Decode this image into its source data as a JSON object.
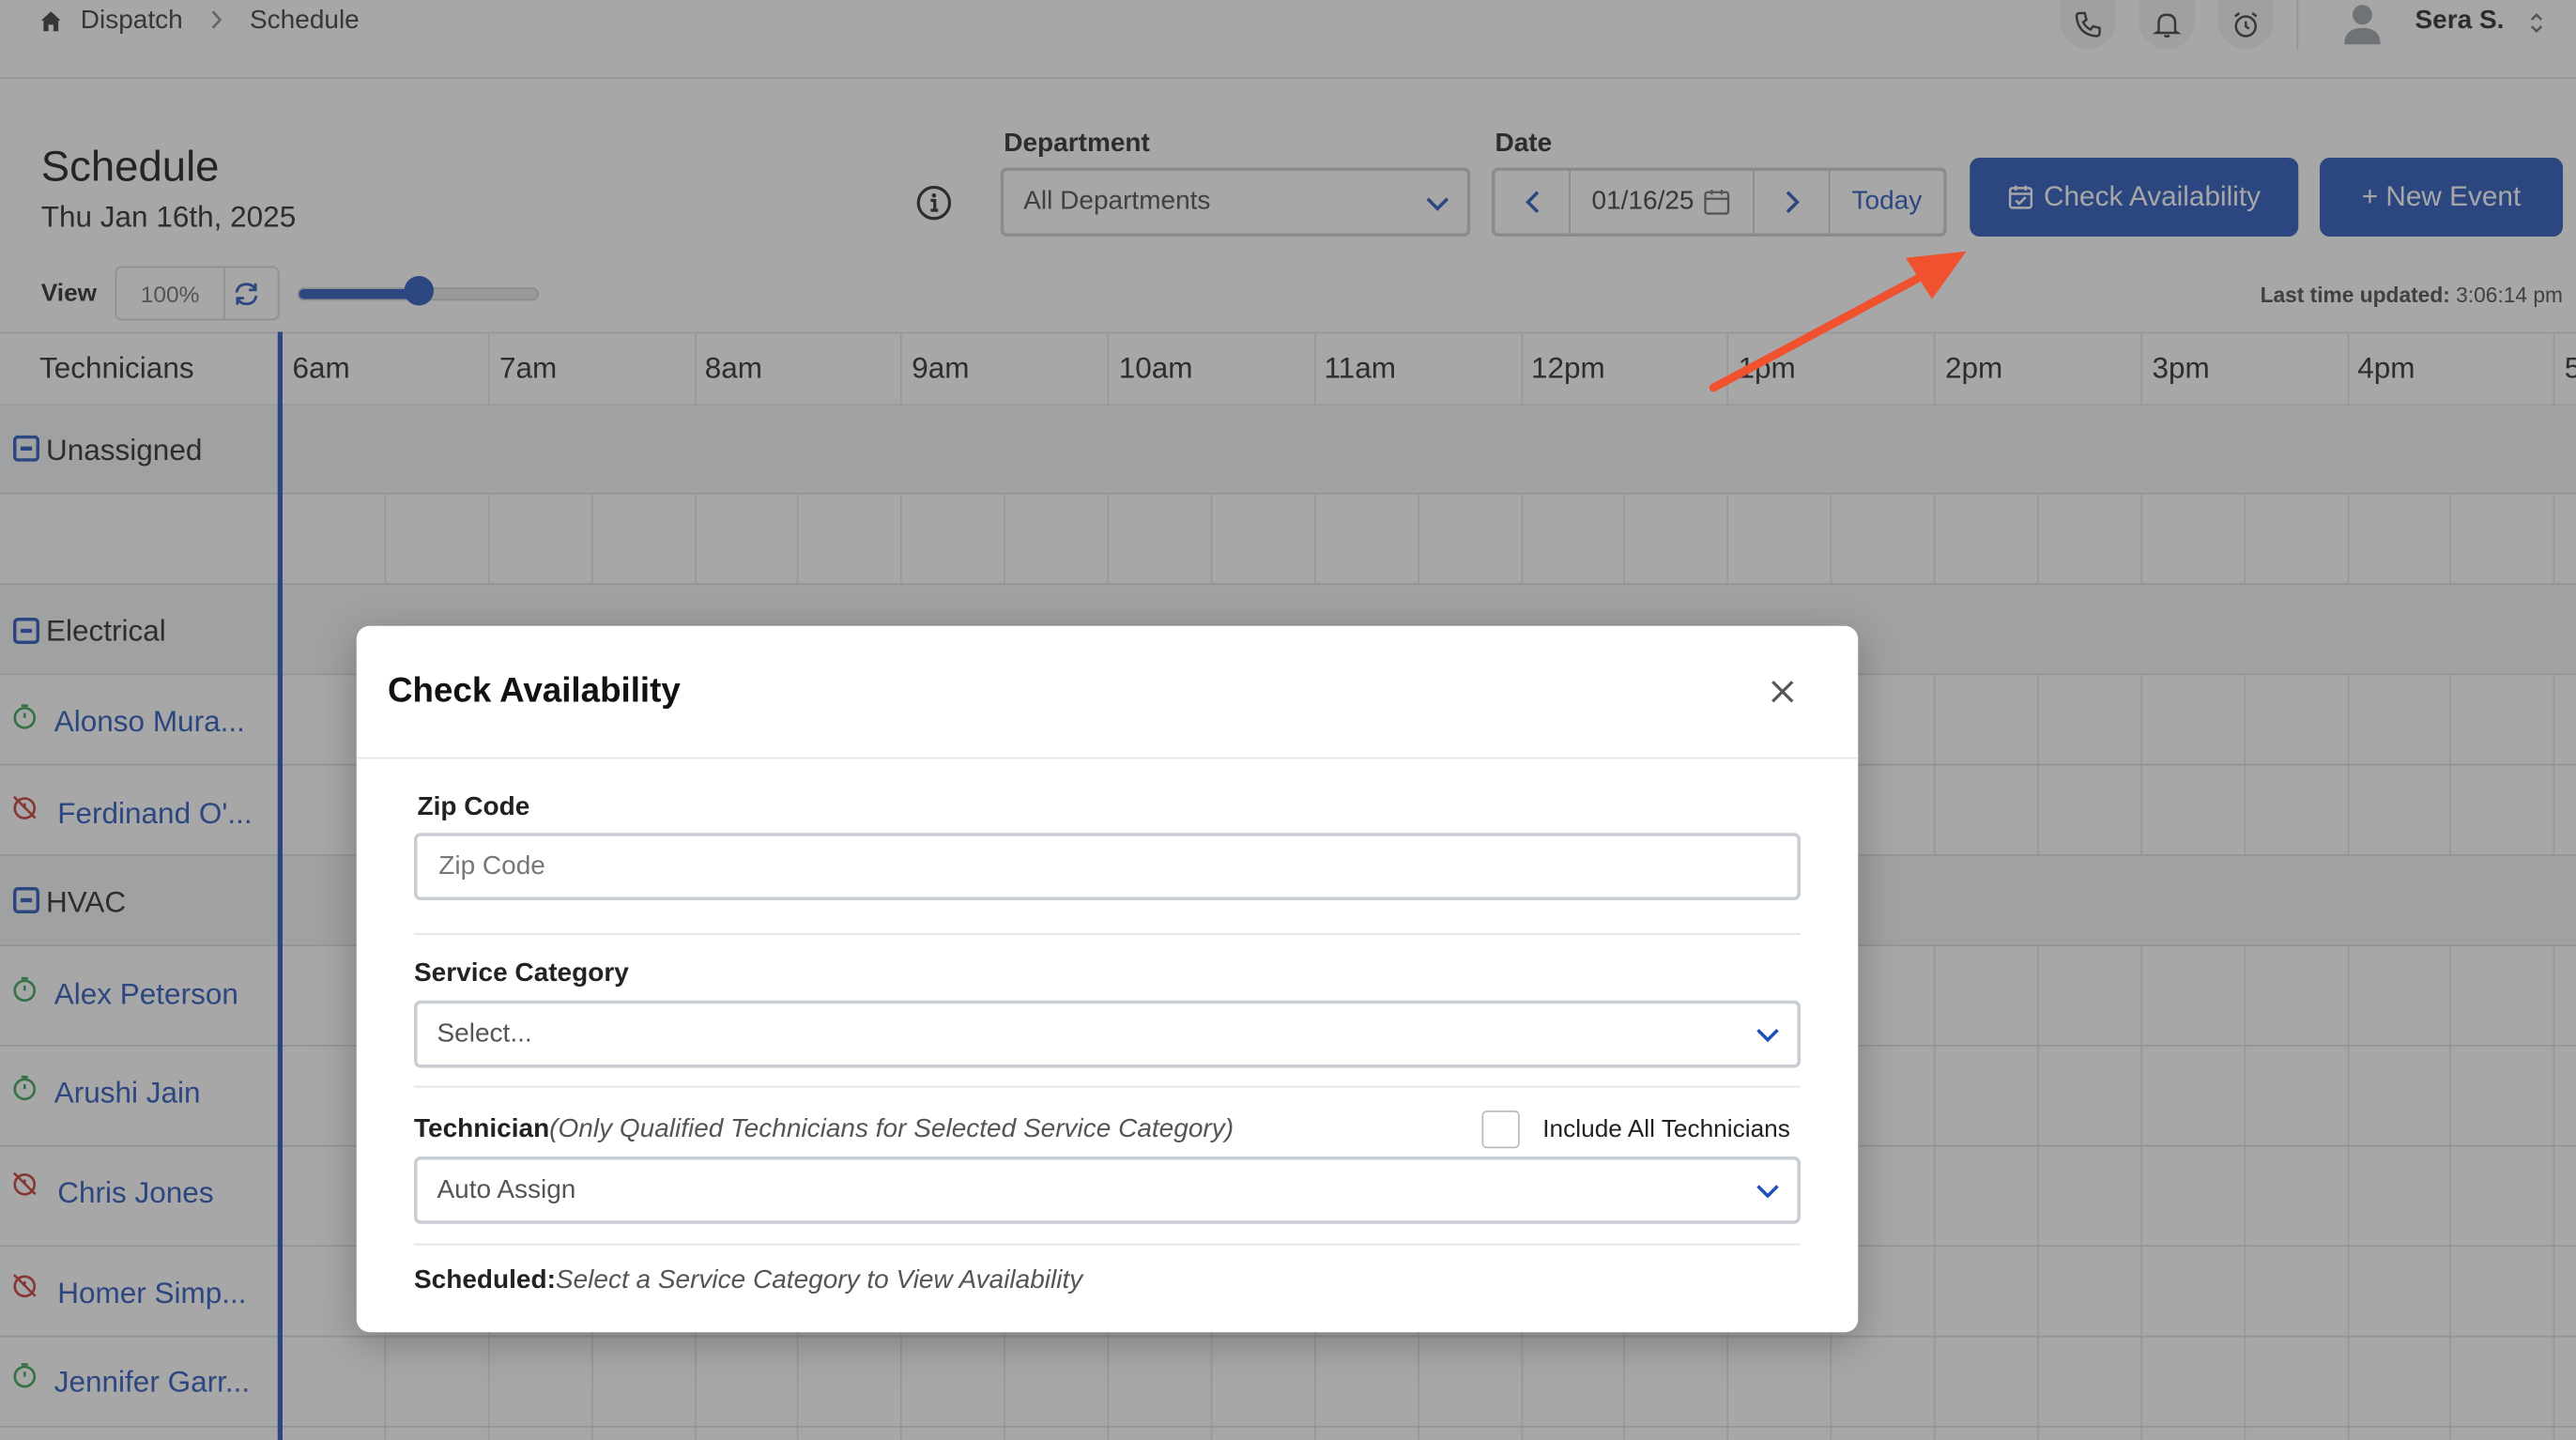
{
  "breadcrumb": {
    "dispatch": "Dispatch",
    "schedule": "Schedule"
  },
  "user": {
    "name": "Sera S."
  },
  "header": {
    "title": "Schedule",
    "date": "Thu Jan 16th, 2025"
  },
  "filters": {
    "department_label": "Department",
    "department_value": "All Departments",
    "date_label": "Date",
    "date_value": "01/16/25",
    "today_label": "Today"
  },
  "actions": {
    "check_availability": "Check Availability",
    "new_event": "+ New Event"
  },
  "view": {
    "label": "View",
    "zoom": "100%",
    "slider_fraction": 0.5
  },
  "last_updated": {
    "label": "Last time updated:",
    "time": "3:06:14 pm"
  },
  "grid": {
    "technicians_header": "Technicians",
    "hours": [
      "6am",
      "7am",
      "8am",
      "9am",
      "10am",
      "11am",
      "12pm",
      "1pm",
      "2pm",
      "3pm",
      "4pm",
      "5"
    ],
    "groups": {
      "unassigned": "Unassigned",
      "electrical": "Electrical",
      "hvac": "HVAC"
    },
    "technicians": {
      "alonso": "Alonso Mura...",
      "ferdinand": "Ferdinand O'...",
      "alex": "Alex Peterson",
      "arushi": "Arushi Jain",
      "chris": "Chris Jones",
      "homer": "Homer Simp...",
      "jennifer": "Jennifer Garr..."
    }
  },
  "modal": {
    "title": "Check Availability",
    "zip_label": "Zip Code",
    "zip_placeholder": "Zip Code",
    "category_label": "Service Category",
    "category_value": "Select...",
    "technician_label": "Technician",
    "technician_hint": "(Only Qualified Technicians for Selected Service Category)",
    "include_all_label": "Include All Technicians",
    "technician_value": "Auto Assign",
    "scheduled_label": "Scheduled:",
    "scheduled_hint": "Select a Service Category to View Availability"
  },
  "colors": {
    "accent": "#1f4fb8",
    "available": "#2e9e4a",
    "unavailable": "#c4322f",
    "annotation": "#f0522f"
  }
}
